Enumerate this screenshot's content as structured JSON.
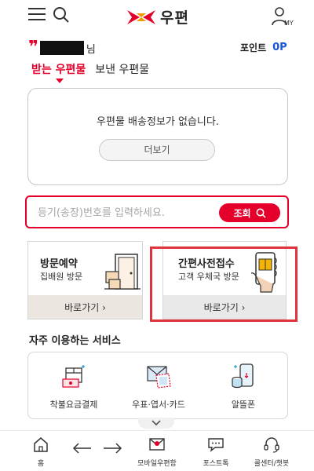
{
  "header": {
    "logo_text": "우편"
  },
  "user": {
    "honorific": "님",
    "points_label": "포인트",
    "points_value": "0P"
  },
  "tabs": [
    {
      "label": "받는 우편물",
      "active": true
    },
    {
      "label": "보낸 우편물",
      "active": false
    }
  ],
  "delivery_info": {
    "message": "우편물 배송정보가 없습니다.",
    "more_label": "더보기"
  },
  "tracking_search": {
    "placeholder": "등기(송장)번호를 입력하세요.",
    "button_label": "조회"
  },
  "service_cards": [
    {
      "title": "방문예약",
      "subtitle": "집배원 방문",
      "go_label": "바로가기  ›"
    },
    {
      "title": "간편사전접수",
      "subtitle": "고객 우체국 방문",
      "go_label": "바로가기  ›"
    }
  ],
  "frequent_services": {
    "title": "자주 이용하는 서비스",
    "items": [
      {
        "label": "착불요금결제",
        "icon": "cod-payment-icon"
      },
      {
        "label": "우표·엽서·카드",
        "icon": "stamp-postcard-icon"
      },
      {
        "label": "알뜰폰",
        "icon": "budget-phone-icon"
      }
    ]
  },
  "bottom_nav": {
    "home_label": "홈",
    "mobile_post_label": "모바일우편함",
    "post_talk_label": "포스트톡",
    "call_center_label": "콜센터/챗봇"
  },
  "colors": {
    "brand_red": "#e4002b",
    "points_blue": "#1a56db",
    "highlight": "#e0343c"
  }
}
